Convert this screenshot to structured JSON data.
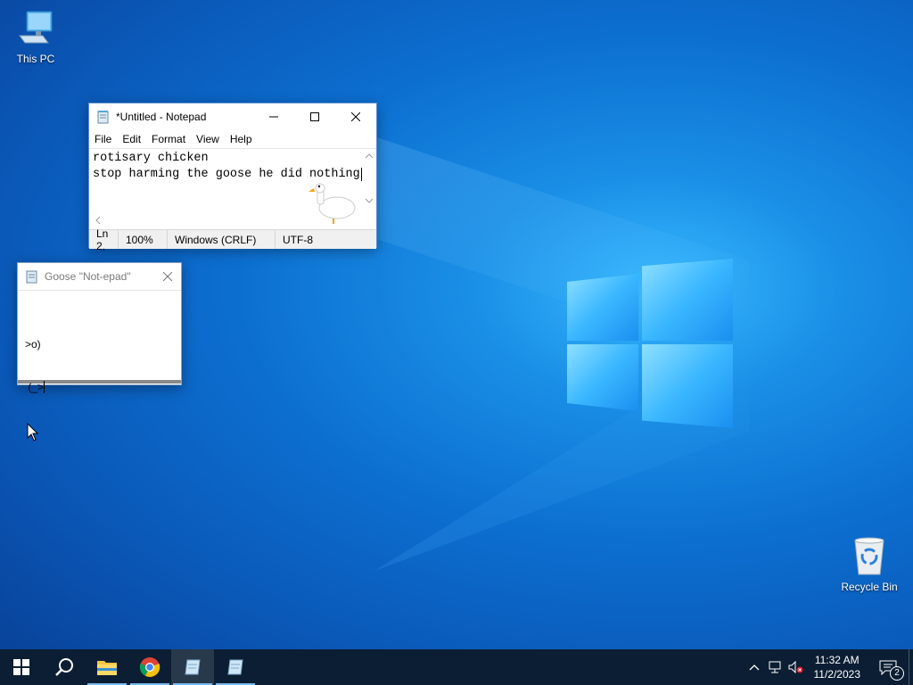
{
  "desktop": {
    "icons": [
      {
        "label": "This PC"
      },
      {
        "label": "Recycle Bin"
      }
    ]
  },
  "notepad": {
    "title": "*Untitled - Notepad",
    "menu": [
      "File",
      "Edit",
      "Format",
      "View",
      "Help"
    ],
    "lines": [
      "rotisary chicken",
      "stop harming the goose he did nothing"
    ],
    "status": {
      "position": "Ln 2,",
      "zoom": "100%",
      "line_ending": "Windows (CRLF)",
      "encoding": "UTF-8"
    }
  },
  "goose_note": {
    "title": "Goose \"Not-epad\"",
    "lines": [
      ">o)",
      " (_>"
    ]
  },
  "taskbar": {
    "clock_time": "11:32 AM",
    "clock_date": "11/2/2023",
    "notification_count": "2"
  },
  "colors": {
    "taskbar_bg": "#0b1e33",
    "accent": "#76b9ed",
    "folder_yellow": "#f5c543"
  }
}
